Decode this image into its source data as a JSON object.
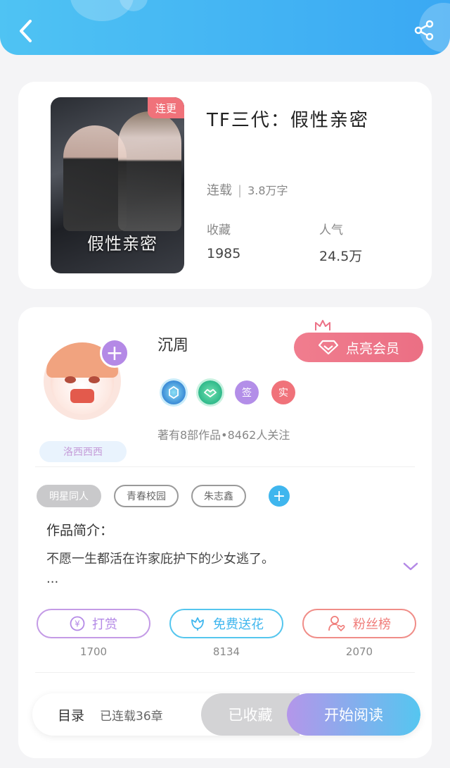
{
  "colors": {
    "header": "#4fc3f3",
    "vip": "#ec7287",
    "purple": "#b489e6",
    "cyan": "#3fb6ee",
    "coral": "#f07d7a",
    "badge_red": "#f0727a"
  },
  "header": {
    "back_icon": "chevron-left-icon",
    "share_icon": "share-icon"
  },
  "book": {
    "cover_badge": "连更",
    "cover_title": "假性亲密",
    "cover_subtitle": "",
    "title": "TF三代：假性亲密",
    "status": "连载",
    "word_count": "3.8万字",
    "favorites_label": "收藏",
    "favorites_value": "1985",
    "popularity_label": "人气",
    "popularity_value": "24.5万"
  },
  "author": {
    "name": "沉周",
    "nameplate": "洛西西西",
    "vip_button": "点亮会员",
    "badges": [
      "",
      "",
      "签",
      "实"
    ],
    "meta": "著有8部作品•8462人关注"
  },
  "tags": [
    "明星同人",
    "青春校园",
    "朱志鑫"
  ],
  "intro": {
    "title": "作品简介：",
    "text": "不愿一生都活在许家庇护下的少女逃了。",
    "ellipsis": "..."
  },
  "actions": [
    {
      "label": "打赏",
      "count": "1700",
      "icon": "yen-icon"
    },
    {
      "label": "免费送花",
      "count": "8134",
      "icon": "flower-icon"
    },
    {
      "label": "粉丝榜",
      "count": "2070",
      "icon": "user-heart-icon"
    }
  ],
  "bottom": {
    "toc_label": "目录",
    "chapters": "已连载36章",
    "collected_label": "已收藏",
    "read_label": "开始阅读"
  }
}
